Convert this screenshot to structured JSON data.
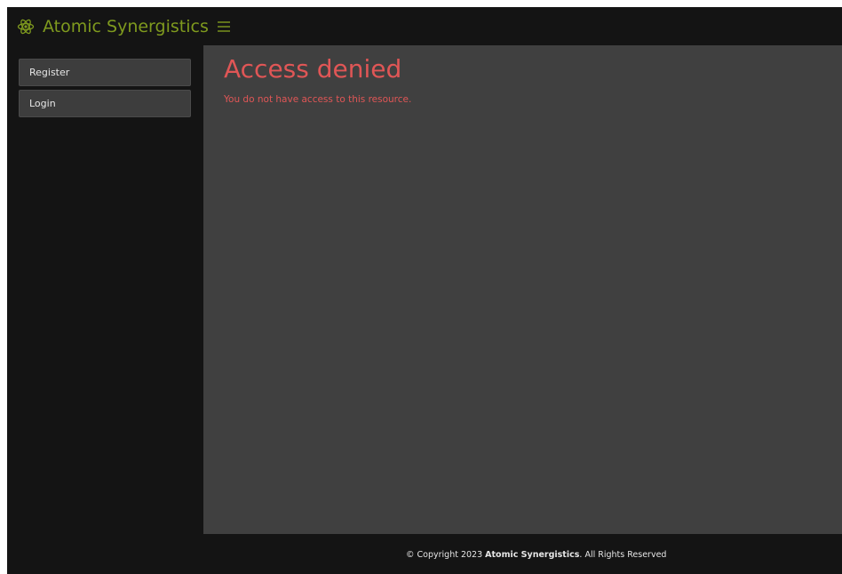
{
  "header": {
    "brand_title": "Atomic Synergistics",
    "brand_icon": "atom-icon",
    "menu_icon": "hamburger-menu-icon",
    "brand_color": "#7f9a1e"
  },
  "sidebar": {
    "items": [
      {
        "label": "Register"
      },
      {
        "label": "Login"
      }
    ]
  },
  "main": {
    "title": "Access denied",
    "message": "You do not have access to this resource.",
    "error_color": "#e05656"
  },
  "footer": {
    "prefix": "© Copyright 2023 ",
    "company": "Atomic Synergistics",
    "suffix": ". All Rights Reserved"
  }
}
